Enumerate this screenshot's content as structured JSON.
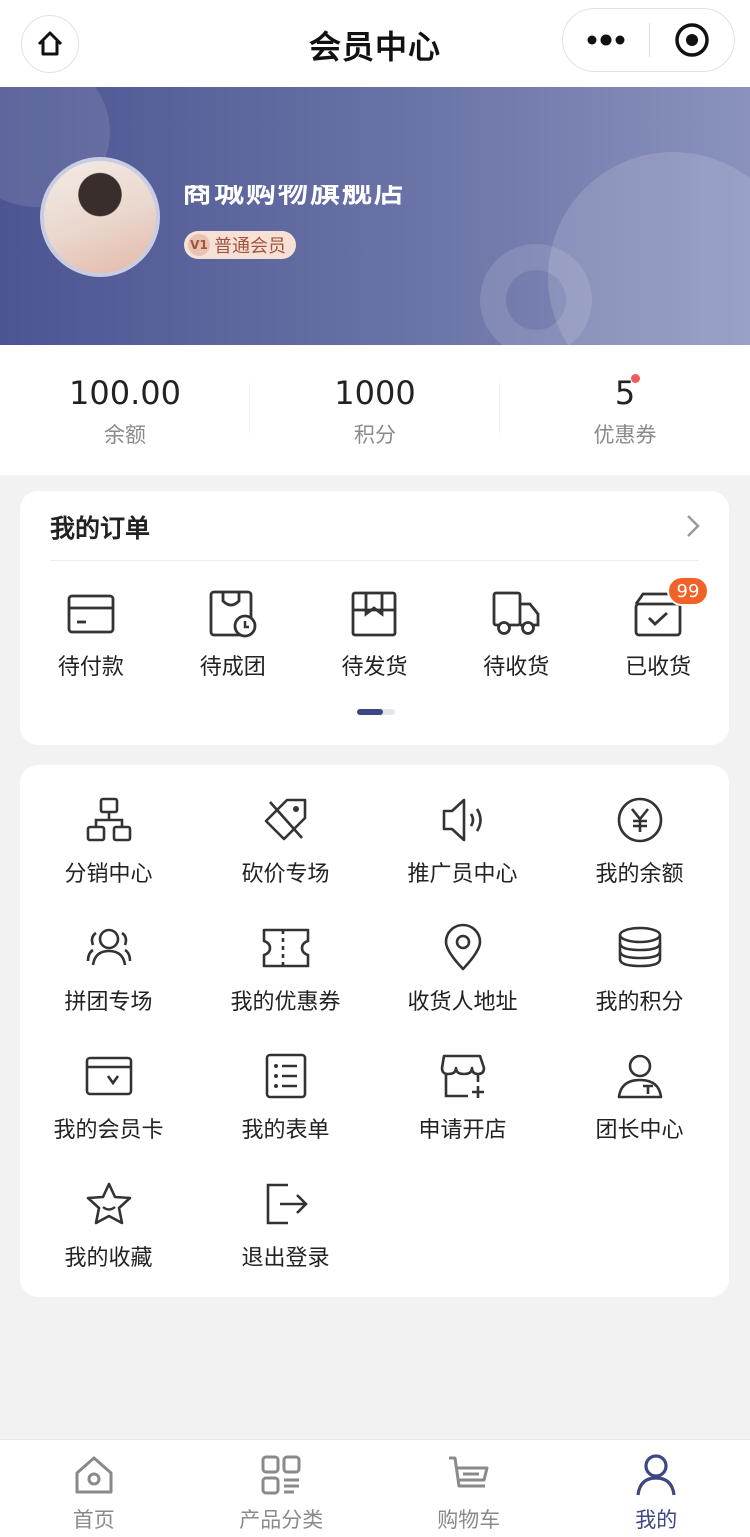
{
  "nav": {
    "title": "会员中心"
  },
  "banner": {
    "shop_name": "商城购物旗舰店",
    "member_level": "普通会员",
    "level_icon_text": "V1"
  },
  "stats": [
    {
      "value": "100.00",
      "label": "余额"
    },
    {
      "value": "1000",
      "label": "积分"
    },
    {
      "value": "5",
      "label": "优惠券"
    }
  ],
  "orders": {
    "title": "我的订单",
    "items": [
      {
        "label": "待付款",
        "icon": "card-icon"
      },
      {
        "label": "待成团",
        "icon": "bag-clock-icon"
      },
      {
        "label": "待发货",
        "icon": "box-icon"
      },
      {
        "label": "待收货",
        "icon": "truck-icon"
      },
      {
        "label": "已收货",
        "icon": "received-box-icon"
      }
    ],
    "badge": "99"
  },
  "services": [
    {
      "label": "分销中心",
      "icon": "org-chart-icon"
    },
    {
      "label": "砍价专场",
      "icon": "price-tag-icon"
    },
    {
      "label": "推广员中心",
      "icon": "speaker-icon"
    },
    {
      "label": "我的余额",
      "icon": "yen-coin-icon"
    },
    {
      "label": "拼团专场",
      "icon": "group-icon"
    },
    {
      "label": "我的优惠券",
      "icon": "ticket-icon"
    },
    {
      "label": "收货人地址",
      "icon": "location-icon"
    },
    {
      "label": "我的积分",
      "icon": "coins-stack-icon"
    },
    {
      "label": "我的会员卡",
      "icon": "member-card-icon"
    },
    {
      "label": "我的表单",
      "icon": "form-list-icon"
    },
    {
      "label": "申请开店",
      "icon": "store-add-icon"
    },
    {
      "label": "团长中心",
      "icon": "leader-icon"
    },
    {
      "label": "我的收藏",
      "icon": "star-icon"
    },
    {
      "label": "退出登录",
      "icon": "logout-icon"
    }
  ],
  "tabbar": [
    {
      "label": "首页",
      "icon": "home-icon"
    },
    {
      "label": "产品分类",
      "icon": "category-icon"
    },
    {
      "label": "购物车",
      "icon": "cart-icon"
    },
    {
      "label": "我的",
      "icon": "user-icon"
    }
  ],
  "colors": {
    "accent": "#3c4784",
    "badge": "#f06228",
    "dot": "#f05a5a"
  }
}
